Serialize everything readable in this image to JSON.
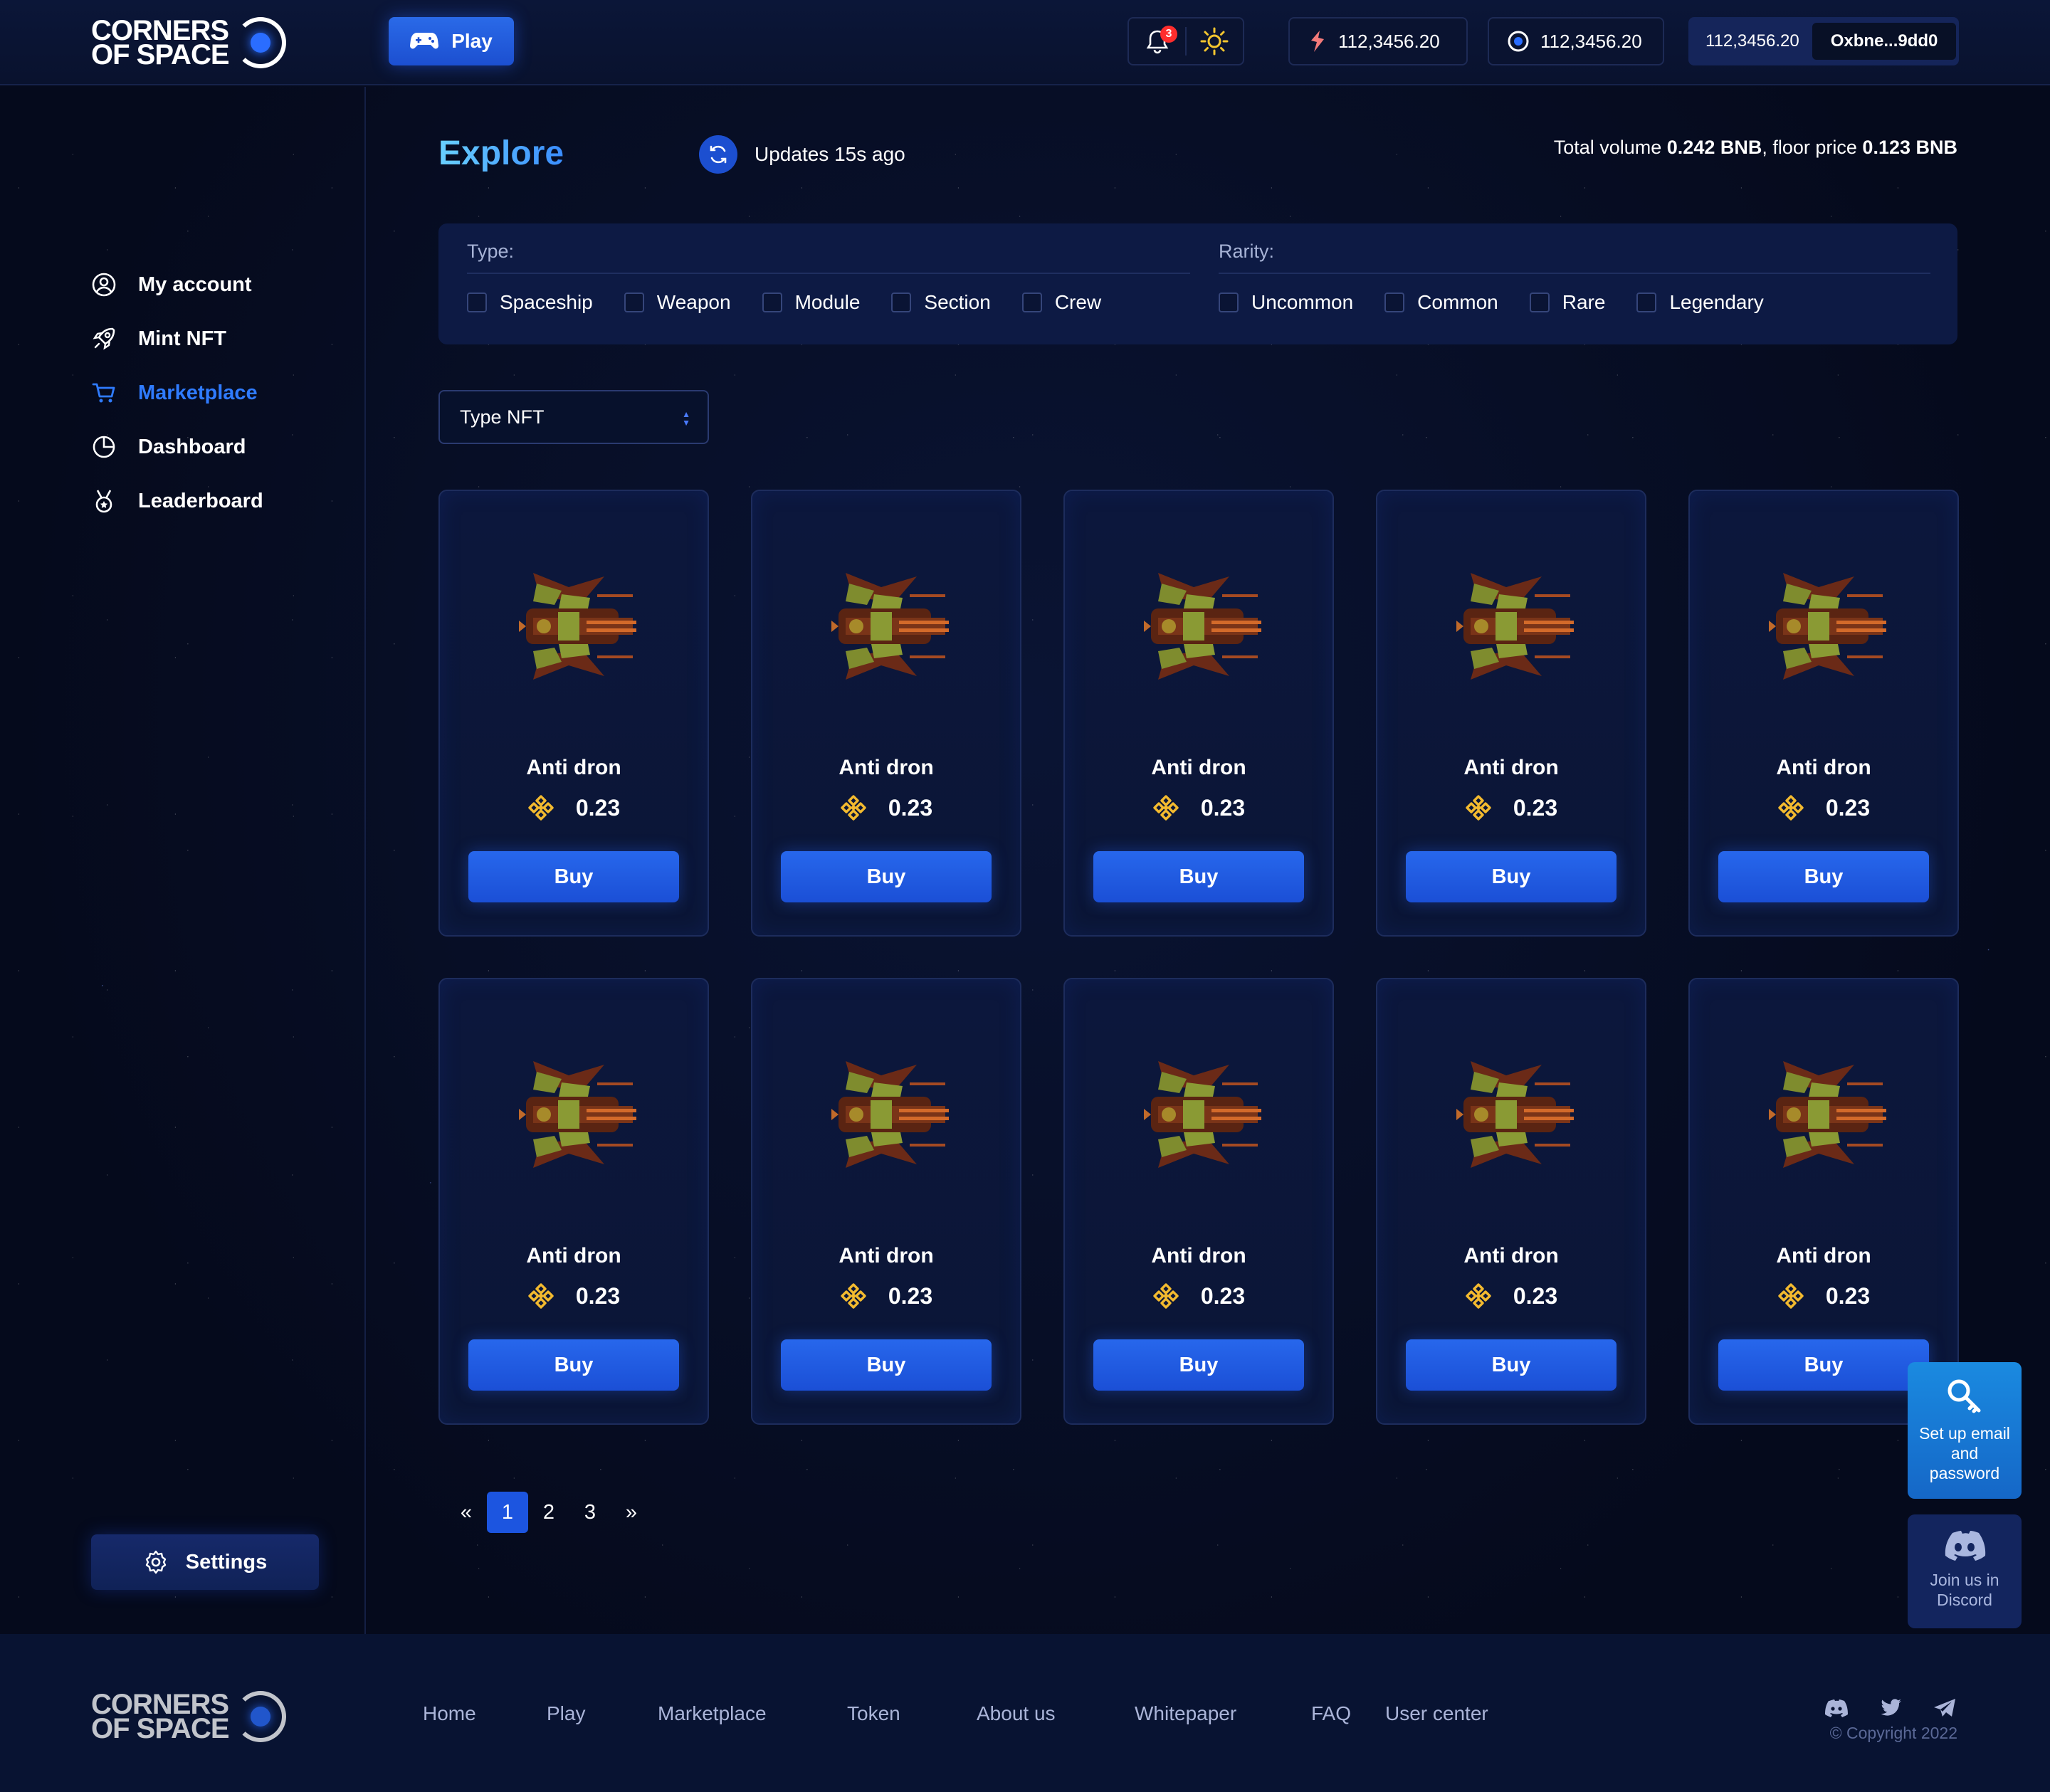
{
  "brand": {
    "line1": "CORNERS",
    "line2": "OF SPACE"
  },
  "header": {
    "play_label": "Play",
    "notification_count": "3",
    "balance_1": "112,3456.20",
    "balance_2": "112,3456.20",
    "wallet_balance": "112,3456.20",
    "wallet_address": "Oxbne...9dd0"
  },
  "sidebar": {
    "items": [
      {
        "label": "My account",
        "icon": "user-circle-icon"
      },
      {
        "label": "Mint NFT",
        "icon": "rocket-icon"
      },
      {
        "label": "Marketplace",
        "icon": "cart-icon",
        "active": true
      },
      {
        "label": "Dashboard",
        "icon": "pie-chart-icon"
      },
      {
        "label": "Leaderboard",
        "icon": "medal-icon"
      }
    ],
    "settings_label": "Settings"
  },
  "main": {
    "title": "Explore",
    "updates": "Updates 15s ago",
    "volume_prefix": "Total volume ",
    "volume_value": "0.242 BNB",
    "floor_prefix": ", floor price ",
    "floor_value": "0.123 BNB"
  },
  "filters": {
    "type_label": "Type:",
    "type_options": [
      "Spaceship",
      "Weapon",
      "Module",
      "Section",
      "Crew"
    ],
    "rarity_label": "Rarity:",
    "rarity_options": [
      "Uncommon",
      "Common",
      "Rare",
      "Legendary"
    ]
  },
  "select": {
    "value": "Type NFT"
  },
  "cards": [
    {
      "name": "Anti dron",
      "price": "0.23",
      "button": "Buy"
    },
    {
      "name": "Anti dron",
      "price": "0.23",
      "button": "Buy"
    },
    {
      "name": "Anti dron",
      "price": "0.23",
      "button": "Buy"
    },
    {
      "name": "Anti dron",
      "price": "0.23",
      "button": "Buy"
    },
    {
      "name": "Anti dron",
      "price": "0.23",
      "button": "Buy"
    },
    {
      "name": "Anti dron",
      "price": "0.23",
      "button": "Buy"
    },
    {
      "name": "Anti dron",
      "price": "0.23",
      "button": "Buy"
    },
    {
      "name": "Anti dron",
      "price": "0.23",
      "button": "Buy"
    },
    {
      "name": "Anti dron",
      "price": "0.23",
      "button": "Buy"
    },
    {
      "name": "Anti dron",
      "price": "0.23",
      "button": "Buy"
    }
  ],
  "pagination": {
    "prev": "«",
    "pages": [
      "1",
      "2",
      "3"
    ],
    "current": "1",
    "next": "»"
  },
  "floating": {
    "account_setup": "Set up email and password",
    "discord": "Join us in Discord"
  },
  "footer": {
    "links": [
      "Home",
      "Play",
      "Marketplace",
      "Token",
      "About us",
      "Whitepaper",
      "FAQ",
      "User center"
    ],
    "copyright": "© Copyright 2022"
  },
  "colors": {
    "accent": "#2f7bff",
    "button": "#1c55e0",
    "bnb": "#f3ba2f",
    "background": "#050a1c"
  }
}
